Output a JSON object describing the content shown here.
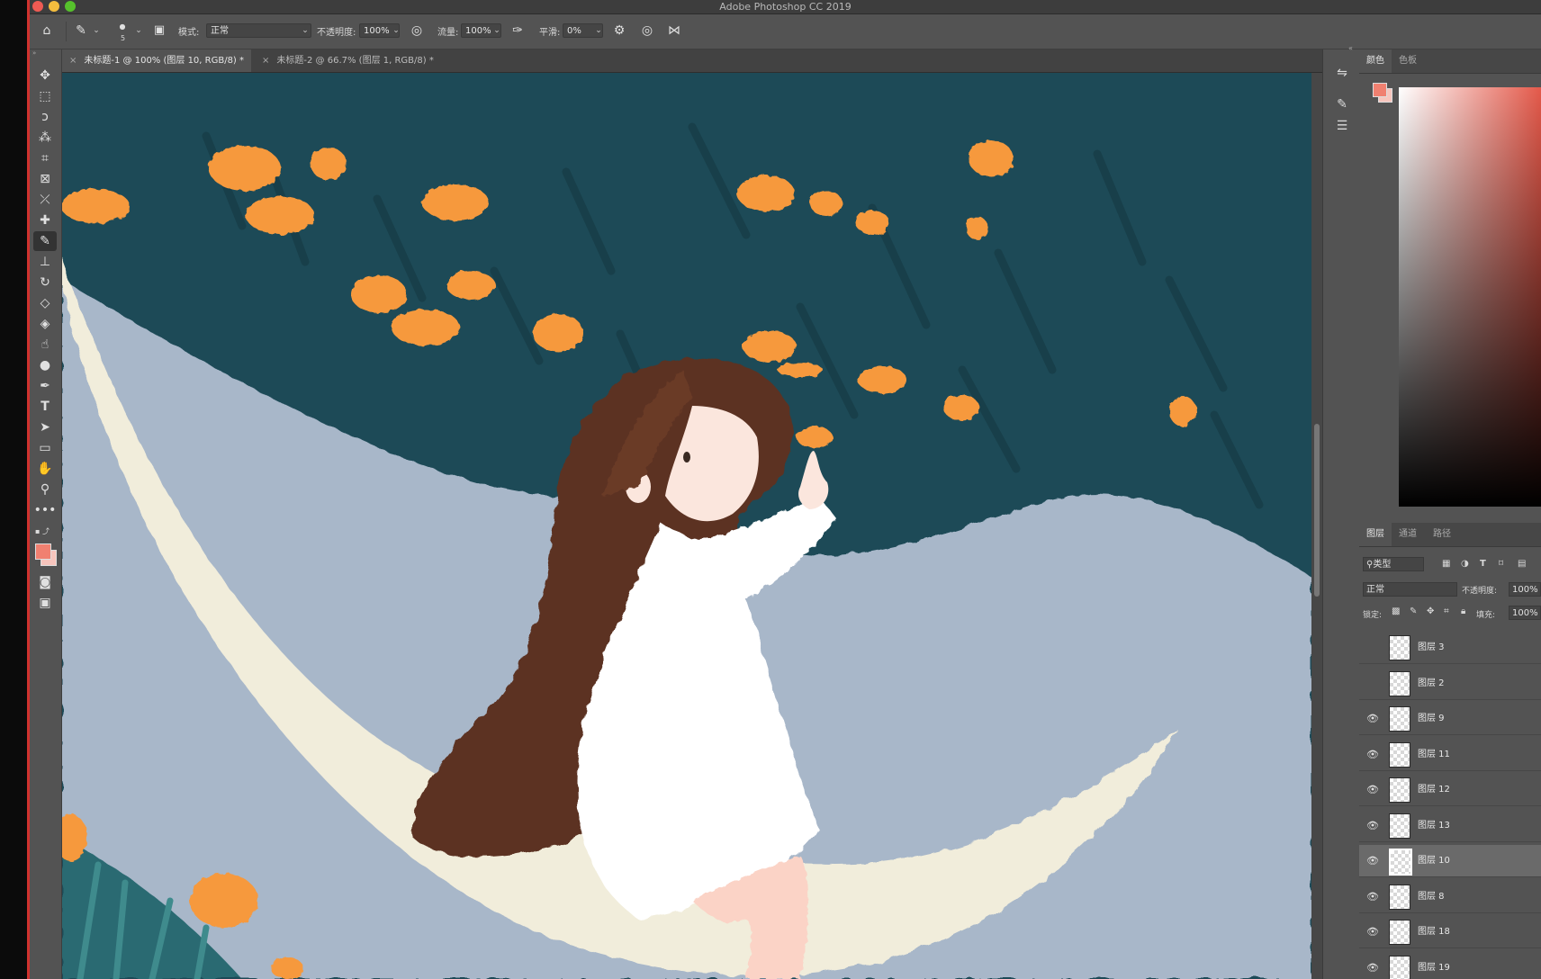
{
  "window": {
    "title": "Adobe Photoshop CC 2019"
  },
  "options_bar": {
    "brush_size": "5",
    "mode_label": "模式:",
    "mode_value": "正常",
    "opacity_label": "不透明度:",
    "opacity_value": "100%",
    "flow_label": "流量:",
    "flow_value": "100%",
    "smoothing_label": "平滑:",
    "smoothing_value": "0%"
  },
  "tabs": [
    {
      "label": "未标题-1 @ 100% (图层 10, RGB/8) *",
      "active": true
    },
    {
      "label": "未标题-2 @ 66.7% (图层 1, RGB/8) *",
      "active": false
    }
  ],
  "colors": {
    "foreground": "#f08070",
    "background": "#f7c5bd",
    "accent_red": "#d0322e"
  },
  "color_panel": {
    "tabs": [
      "颜色",
      "色板"
    ]
  },
  "layers_panel": {
    "tabs": [
      "图层",
      "通道",
      "路径"
    ],
    "filter_label": "类型",
    "blend_mode": "正常",
    "opacity_label": "不透明度:",
    "opacity_value": "100%",
    "lock_label": "锁定:",
    "fill_label": "填充:",
    "fill_value": "100%",
    "layers": [
      {
        "name": "图层 3",
        "visible": false,
        "selected": false
      },
      {
        "name": "图层 2",
        "visible": false,
        "selected": false
      },
      {
        "name": "图层 9",
        "visible": true,
        "selected": false
      },
      {
        "name": "图层 11",
        "visible": true,
        "selected": false
      },
      {
        "name": "图层 12",
        "visible": true,
        "selected": false
      },
      {
        "name": "图层 13",
        "visible": true,
        "selected": false
      },
      {
        "name": "图层 10",
        "visible": true,
        "selected": true
      },
      {
        "name": "图层 8",
        "visible": true,
        "selected": false
      },
      {
        "name": "图层 18",
        "visible": true,
        "selected": false
      },
      {
        "name": "图层 19",
        "visible": true,
        "selected": false
      }
    ]
  },
  "tools": [
    "move-icon",
    "marquee-icon",
    "lasso-icon",
    "magic-wand-icon",
    "crop-icon",
    "frame-icon",
    "eyedropper-icon",
    "healing-icon",
    "brush-icon",
    "stamp-icon",
    "history-brush-icon",
    "eraser-icon",
    "bucket-icon",
    "smudge-icon",
    "dodge-icon",
    "pen-icon",
    "type-icon",
    "path-select-icon",
    "rectangle-icon",
    "hand-icon",
    "zoom-icon",
    "more-icon"
  ]
}
